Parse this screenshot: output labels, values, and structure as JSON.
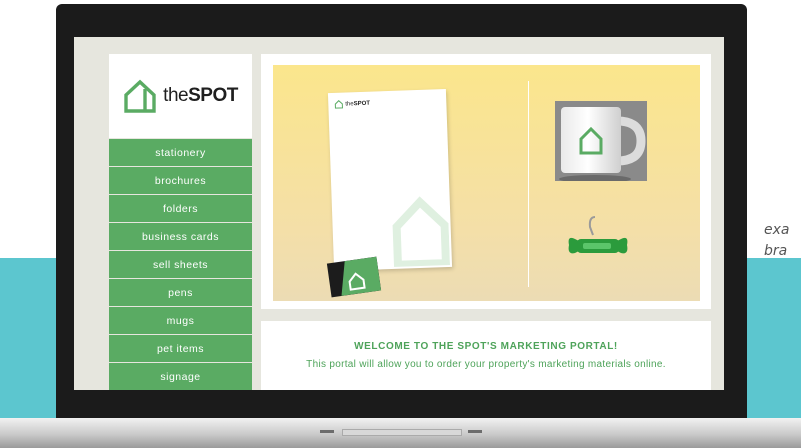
{
  "brand": {
    "logo_text_light": "the",
    "logo_text_bold": "SPOT",
    "green": "#5aab63"
  },
  "nav": {
    "items": [
      {
        "label": "stationery"
      },
      {
        "label": "brochures"
      },
      {
        "label": "folders"
      },
      {
        "label": "business cards"
      },
      {
        "label": "sell sheets"
      },
      {
        "label": "pens"
      },
      {
        "label": "mugs"
      },
      {
        "label": "pet items"
      },
      {
        "label": "signage"
      }
    ]
  },
  "welcome": {
    "title": "WELCOME TO THE SPOT'S MARKETING PORTAL!",
    "subtitle": "This portal will allow you to order your property's marketing materials online."
  },
  "side_caption": {
    "line1": "exa",
    "line2": "bra"
  },
  "icons": [
    "house-logo-icon"
  ],
  "colors": {
    "teal_band": "#5cc6cf",
    "hero_yellow": "#fbe68c",
    "bezel": "#1b1b1b"
  }
}
